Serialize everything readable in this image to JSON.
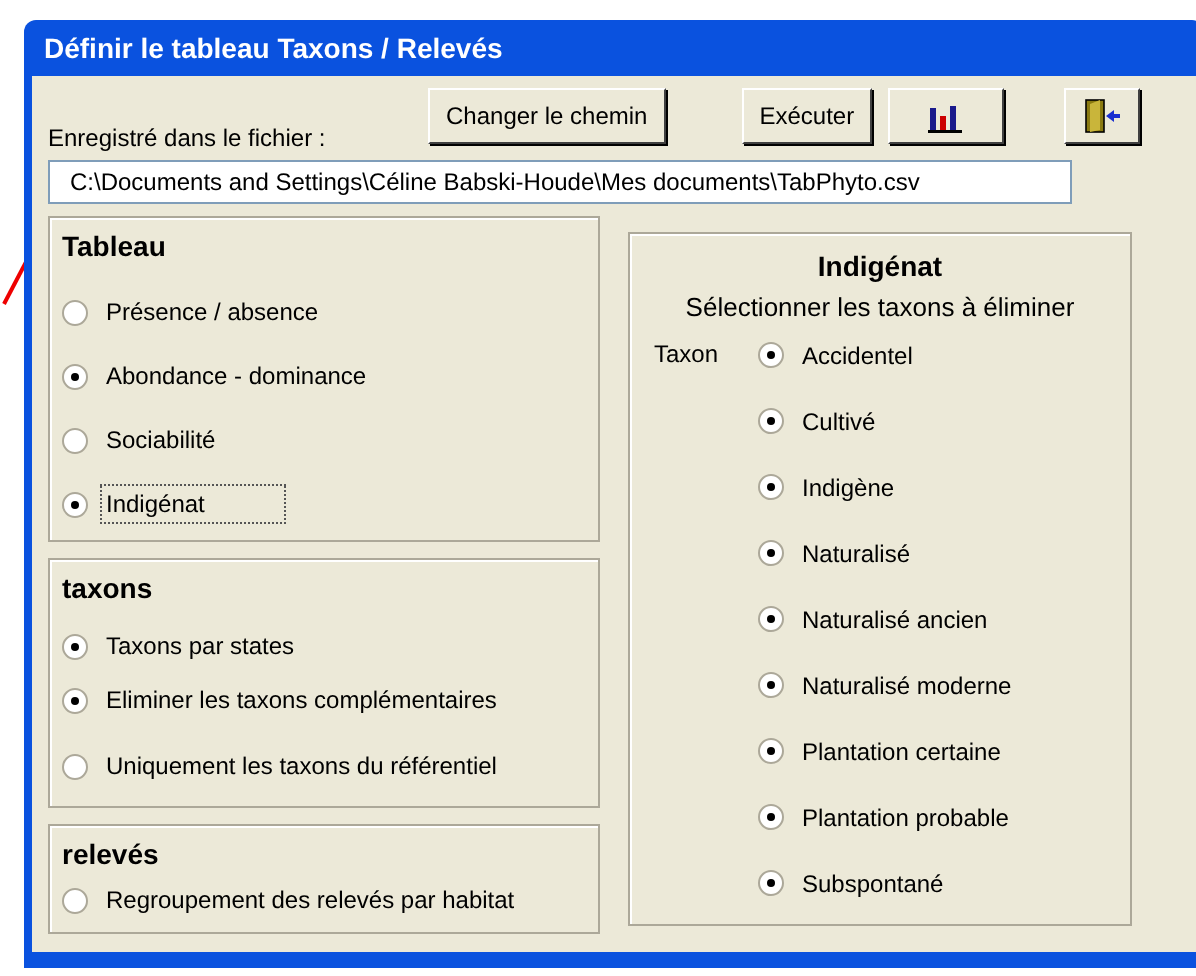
{
  "window": {
    "title": "Définir le tableau Taxons / Relevés"
  },
  "file_label": "Enregistré dans le fichier :",
  "file_path": "C:\\Documents and Settings\\Céline Babski-Houde\\Mes documents\\TabPhyto.csv",
  "buttons": [
    {
      "kind": "text",
      "label": "Changer le chemin"
    },
    {
      "kind": "text",
      "label": "Exécuter"
    },
    {
      "kind": "chart-icon"
    },
    {
      "kind": "exit-icon"
    }
  ],
  "groups": [
    {
      "title": "Tableau",
      "options": [
        {
          "label": "Présence / absence",
          "checked": false,
          "focused": false
        },
        {
          "label": "Abondance - dominance",
          "checked": true,
          "focused": false
        },
        {
          "label": "Sociabilité",
          "checked": false,
          "focused": false
        },
        {
          "label": "Indigénat",
          "checked": true,
          "focused": true
        }
      ]
    },
    {
      "title": "taxons",
      "options": [
        {
          "label": "Taxons par states",
          "checked": true,
          "focused": false
        },
        {
          "label": "Eliminer les taxons complémentaires",
          "checked": true,
          "focused": false
        },
        {
          "label": "Uniquement les taxons du référentiel",
          "checked": false,
          "focused": false
        }
      ]
    },
    {
      "title": "relevés",
      "options": [
        {
          "label": "Regroupement des relevés par habitat",
          "checked": false,
          "focused": false
        }
      ]
    }
  ],
  "indigenat": {
    "title": "Indigénat",
    "subtitle": "Sélectionner les taxons à éliminer",
    "label": "Taxon",
    "options": [
      {
        "label": "Accidentel",
        "checked": true
      },
      {
        "label": "Cultivé",
        "checked": true
      },
      {
        "label": "Indigène",
        "checked": true
      },
      {
        "label": "Naturalisé",
        "checked": true
      },
      {
        "label": "Naturalisé ancien",
        "checked": true
      },
      {
        "label": "Naturalisé moderne",
        "checked": true
      },
      {
        "label": "Plantation certaine",
        "checked": true
      },
      {
        "label": "Plantation probable",
        "checked": true
      },
      {
        "label": "Subspontané",
        "checked": true
      }
    ]
  }
}
